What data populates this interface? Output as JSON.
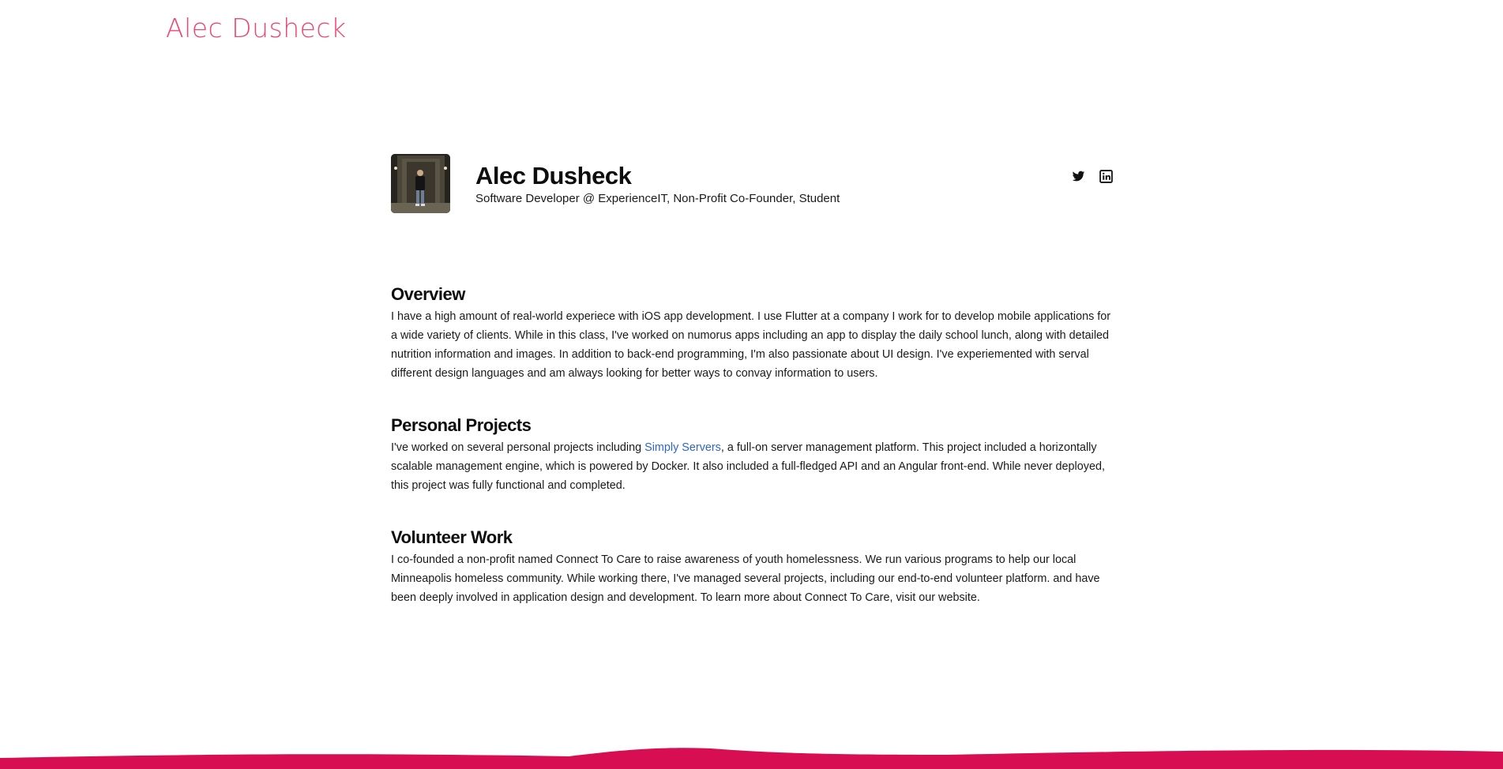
{
  "header": {
    "brand": "Alec Dusheck"
  },
  "profile": {
    "name": "Alec Dusheck",
    "tagline": "Software Developer @ ExperienceIT, Non-Profit Co-Founder, Student",
    "social": [
      "twitter-icon",
      "linkedin-icon"
    ]
  },
  "sections": {
    "overview": {
      "title": "Overview",
      "body": "I have a high amount of real-world experiece with iOS app development. I use Flutter at a company I work for to develop mobile applications for a wide variety of clients. While in this class, I've worked on numorus apps including an app to display the daily school lunch, along with detailed nutrition information and images. In addition to back-end programming, I'm also passionate about UI design. I've experiemented with serval different design languages and am always looking for better ways to convay information to users."
    },
    "projects": {
      "title": "Personal Projects",
      "body_before": "I've worked on several personal projects including ",
      "link_text": "Simply Servers",
      "body_after": ", a full-on server management platform. This project included a horizontally scalable management engine, which is powered by Docker. It also included a full-fledged API and an Angular front-end. While never deployed, this project was fully functional and completed."
    },
    "volunteer": {
      "title": "Volunteer Work",
      "body": "I co-founded a non-profit named Connect To Care to raise awareness of youth homelessness. We run various programs to help our local Minneapolis homeless community. While working there, I've managed several projects, including our end-to-end volunteer platform. and have been deeply involved in application design and development. To learn more about Connect To Care, visit our website."
    }
  },
  "colors": {
    "brand": "#f0456f",
    "link": "#2f66c9",
    "wave": "#d80e52"
  }
}
